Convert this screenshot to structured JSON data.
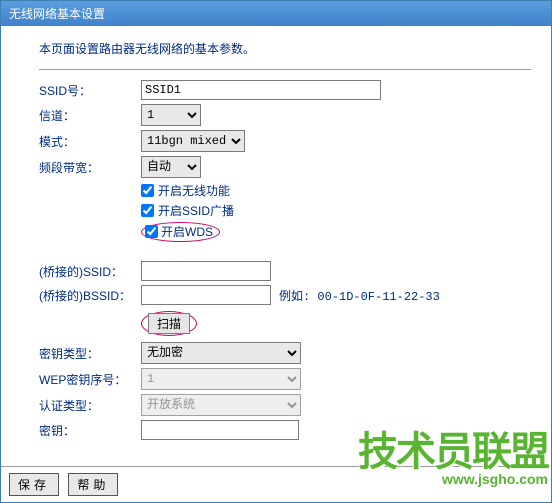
{
  "title": "无线网络基本设置",
  "intro": "本页面设置路由器无线网络的基本参数。",
  "fields": {
    "ssid_label": "SSID号：",
    "ssid_value": "SSID1",
    "channel_label": "信道：",
    "channel_value": "1",
    "mode_label": "模式：",
    "mode_value": "11bgn mixed",
    "bandwidth_label": "频段带宽：",
    "bandwidth_value": "自动"
  },
  "checks": {
    "enable_wifi": "开启无线功能",
    "enable_ssid_bcast": "开启SSID广播",
    "enable_wds": "开启WDS"
  },
  "wds": {
    "bridge_ssid_label": "(桥接的)SSID：",
    "bridge_bssid_label": "(桥接的)BSSID：",
    "bssid_hint": "例如: 00-1D-0F-11-22-33",
    "scan_btn": "扫描",
    "key_type_label": "密钥类型：",
    "key_type_value": "无加密",
    "wep_idx_label": "WEP密钥序号：",
    "wep_idx_value": "1",
    "auth_label": "认证类型：",
    "auth_value": "开放系统",
    "key_label": "密钥："
  },
  "footer": {
    "save": "保存",
    "help": "帮助"
  },
  "watermark": {
    "main": "技术员联盟",
    "url": "www.jsgho.com"
  }
}
